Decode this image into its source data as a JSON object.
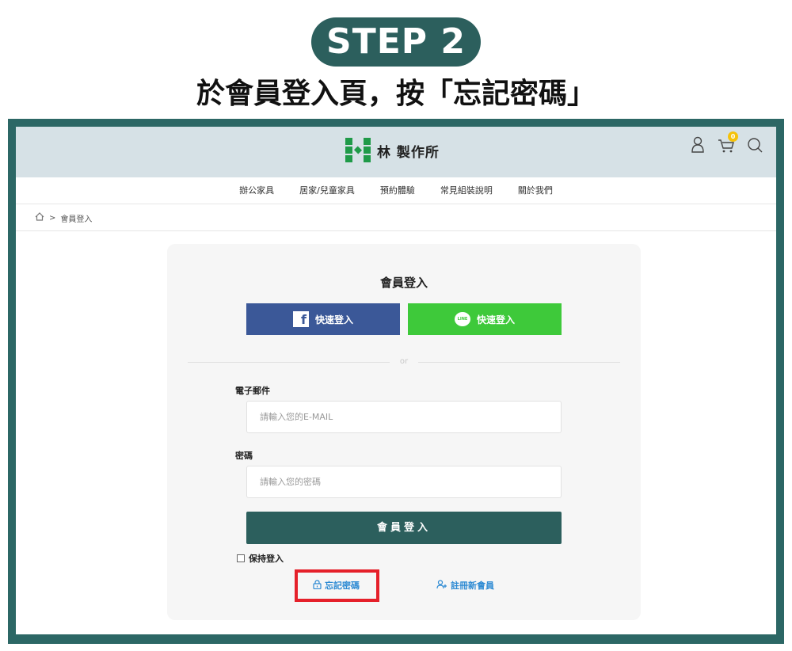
{
  "header": {
    "step": "STEP 2",
    "instruction": "於會員登入頁，按「忘記密碼」"
  },
  "site": {
    "brand": "林 製作所",
    "cart_count": "0"
  },
  "nav": {
    "items": [
      {
        "label": "辦公家具"
      },
      {
        "label": "居家/兒童家具"
      },
      {
        "label": "預約體驗"
      },
      {
        "label": "常見組裝說明"
      },
      {
        "label": "關於我們"
      }
    ]
  },
  "breadcrumb": {
    "separator": ">",
    "current": "會員登入"
  },
  "login": {
    "title": "會員登入",
    "facebook_label": "快速登入",
    "line_label": "快速登入",
    "line_badge": "LINE",
    "or": "or",
    "email_label": "電子郵件",
    "email_placeholder": "請輸入您的E-MAIL",
    "password_label": "密碼",
    "password_placeholder": "請輸入您的密碼",
    "submit_label": "會員登入",
    "remember_label": "保持登入",
    "forgot_label": "忘記密碼",
    "register_label": "註冊新會員"
  },
  "colors": {
    "brand_teal": "#2c5f5d",
    "facebook": "#3b5898",
    "line": "#3ec93a",
    "link": "#2d8ad3",
    "highlight": "#e5202a",
    "logo_green": "#1f9a48"
  }
}
